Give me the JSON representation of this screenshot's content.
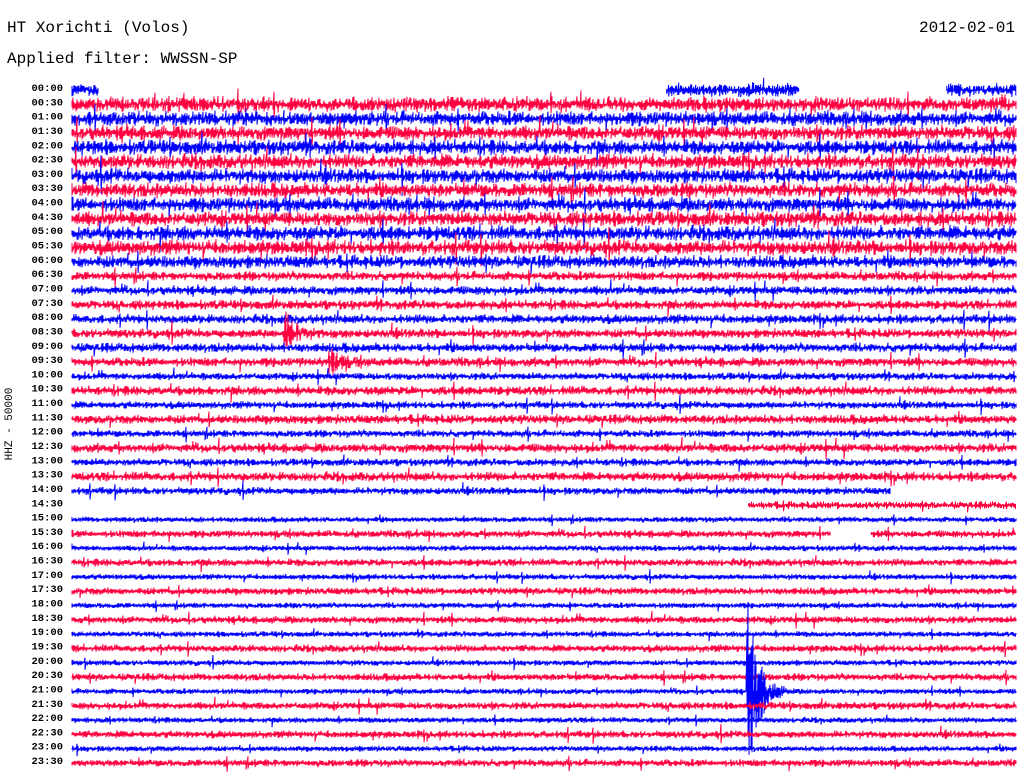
{
  "header": {
    "station": "HT Xorichti (Volos)",
    "filter": "Applied filter: WWSSN-SP",
    "date": "2012-02-01"
  },
  "chart_data": {
    "type": "line",
    "title": "HT Xorichti (Volos)",
    "ylabel": "HHZ - 50000",
    "x_unit": "minutes within row",
    "xlim": [
      0,
      30
    ],
    "colors": [
      "#0000ff",
      "#ff0040"
    ],
    "rows": [
      "00:00",
      "00:30",
      "01:00",
      "01:30",
      "02:00",
      "02:30",
      "03:00",
      "03:30",
      "04:00",
      "04:30",
      "05:00",
      "05:30",
      "06:00",
      "06:30",
      "07:00",
      "07:30",
      "08:00",
      "08:30",
      "09:00",
      "09:30",
      "10:00",
      "10:30",
      "11:00",
      "11:30",
      "12:00",
      "12:30",
      "13:00",
      "13:30",
      "14:00",
      "14:30",
      "15:00",
      "15:30",
      "16:00",
      "16:30",
      "17:00",
      "17:30",
      "18:00",
      "18:30",
      "19:00",
      "19:30",
      "20:00",
      "20:30",
      "21:00",
      "21:30",
      "22:00",
      "22:30",
      "23:00",
      "23:30"
    ],
    "noise_level": [
      7,
      8,
      8,
      8,
      8,
      8,
      8,
      8,
      8,
      8,
      8,
      8,
      7,
      5,
      5,
      5,
      5,
      5,
      5,
      5,
      4,
      5,
      4,
      5,
      4,
      5,
      4,
      5,
      4,
      4,
      3,
      4,
      3,
      4,
      3,
      4,
      3,
      4,
      3,
      4,
      3,
      4,
      3,
      4,
      3,
      4,
      3,
      4
    ],
    "data_segments": {
      "00:00": [
        [
          0,
          0.85
        ],
        [
          18.9,
          23.1
        ],
        [
          27.8,
          30
        ]
      ],
      "14:00": [
        [
          0,
          26.0
        ]
      ],
      "14:30": [
        [
          21.5,
          30
        ]
      ],
      "15:30": [
        [
          0,
          24.1
        ],
        [
          25.4,
          30
        ]
      ]
    },
    "events": [
      {
        "row": "08:30",
        "minute": 6.8,
        "amplitude": 20
      },
      {
        "row": "09:30",
        "minute": 8.2,
        "amplitude": 14
      },
      {
        "row": "21:00",
        "minute": 21.5,
        "amplitude": 90
      }
    ]
  }
}
